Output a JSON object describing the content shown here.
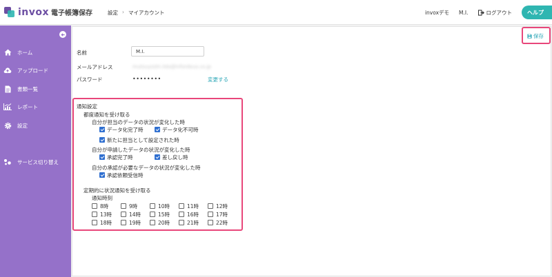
{
  "header": {
    "logo_text": "invox",
    "logo_sub": "電子帳簿保存",
    "breadcrumb": [
      "設定",
      "マイアカウント"
    ],
    "company": "invoxデモ",
    "user": "M.I.",
    "logout_label": "ログアウト",
    "help_label": "ヘルプ",
    "brand_color": "#6d4fa3",
    "accent_color": "#2fb6b1"
  },
  "sidebar": {
    "bg_color": "#9571c9",
    "items": [
      {
        "label": "ホーム",
        "icon": "home-icon"
      },
      {
        "label": "アップロード",
        "icon": "cloud-upload-icon"
      },
      {
        "label": "書類一覧",
        "icon": "document-icon"
      },
      {
        "label": "レポート",
        "icon": "bar-chart-icon"
      },
      {
        "label": "設定",
        "icon": "gear-icon"
      },
      {
        "label": "サービス切り替え",
        "icon": "switch-icon"
      }
    ]
  },
  "toolbar": {
    "save_label": "保存"
  },
  "account": {
    "name_label": "名前",
    "name_value": "M.I.",
    "email_label": "メールアドレス",
    "email_value": "mutsuyoshi.iida@infordeus.co.jp",
    "password_label": "パスワード",
    "password_value": "••••••••",
    "change_link": "変更する"
  },
  "notifications": {
    "title": "通知設定",
    "per_change": {
      "title": "都度通知を受け取る",
      "groups": [
        {
          "title": "自分が担当のデータの状況が変化した時",
          "options": [
            {
              "label": "データ化完了時",
              "checked": true
            },
            {
              "label": "データ化不可時",
              "checked": true
            },
            {
              "label": "新たに担当として設定された時",
              "checked": true
            }
          ]
        },
        {
          "title": "自分が申請したデータの状況が変化した時",
          "options": [
            {
              "label": "承認完了時",
              "checked": true
            },
            {
              "label": "差し戻し時",
              "checked": true
            }
          ]
        },
        {
          "title": "自分の承認が必要なデータの状況が変化した時",
          "options": [
            {
              "label": "承認依頼受信時",
              "checked": true
            }
          ]
        }
      ]
    },
    "periodic": {
      "title": "定期的に状況通知を受け取る",
      "time_label": "通知時刻",
      "hours": [
        {
          "label": "8時",
          "checked": false
        },
        {
          "label": "9時",
          "checked": false
        },
        {
          "label": "10時",
          "checked": false
        },
        {
          "label": "11時",
          "checked": false
        },
        {
          "label": "12時",
          "checked": false
        },
        {
          "label": "13時",
          "checked": false
        },
        {
          "label": "14時",
          "checked": false
        },
        {
          "label": "15時",
          "checked": false
        },
        {
          "label": "16時",
          "checked": false
        },
        {
          "label": "17時",
          "checked": false
        },
        {
          "label": "18時",
          "checked": false
        },
        {
          "label": "19時",
          "checked": false
        },
        {
          "label": "20時",
          "checked": false
        },
        {
          "label": "21時",
          "checked": false
        },
        {
          "label": "22時",
          "checked": false
        }
      ]
    }
  },
  "highlight_color": "#e8467a"
}
